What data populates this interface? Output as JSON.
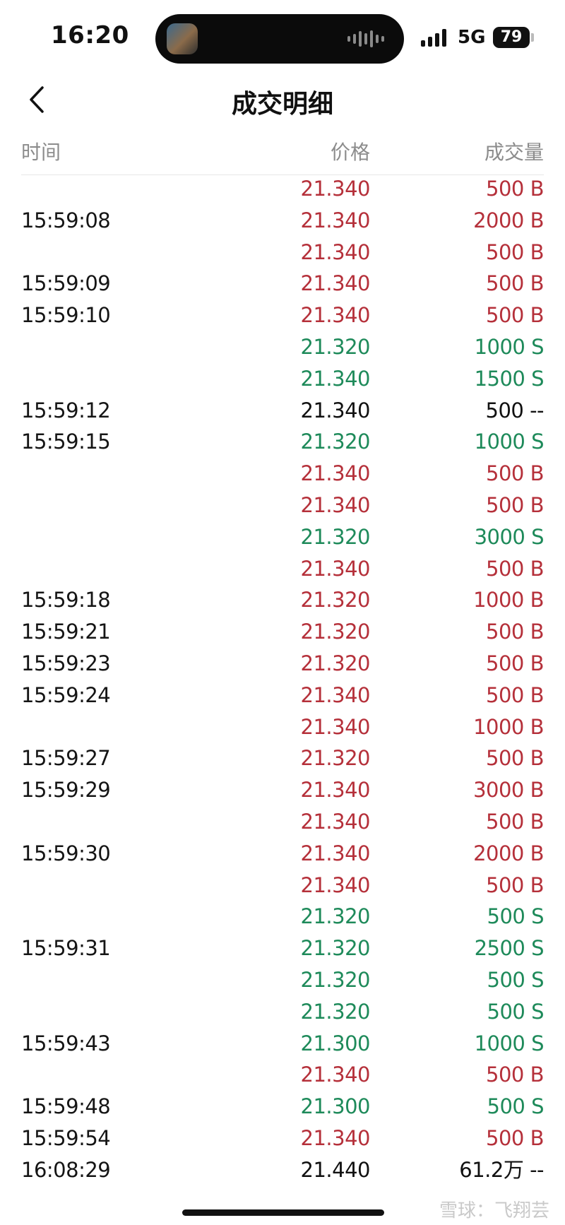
{
  "status_bar": {
    "time": "16:20",
    "network": "5G",
    "battery": "79"
  },
  "header": {
    "title": "成交明细"
  },
  "columns": {
    "time": "时间",
    "price": "价格",
    "volume": "成交量"
  },
  "colors": {
    "buy": "#b5303a",
    "sell": "#1e8a5a",
    "neutral": "#111111"
  },
  "trades": [
    {
      "time": "",
      "price": "21.340",
      "volume": "500 B",
      "side": "red"
    },
    {
      "time": "15:59:08",
      "price": "21.340",
      "volume": "2000 B",
      "side": "red"
    },
    {
      "time": "",
      "price": "21.340",
      "volume": "500 B",
      "side": "red"
    },
    {
      "time": "15:59:09",
      "price": "21.340",
      "volume": "500 B",
      "side": "red"
    },
    {
      "time": "15:59:10",
      "price": "21.340",
      "volume": "500 B",
      "side": "red"
    },
    {
      "time": "",
      "price": "21.320",
      "volume": "1000 S",
      "side": "green"
    },
    {
      "time": "",
      "price": "21.340",
      "volume": "1500 S",
      "side": "green"
    },
    {
      "time": "15:59:12",
      "price": "21.340",
      "volume": "500 --",
      "side": "black"
    },
    {
      "time": "15:59:15",
      "price": "21.320",
      "volume": "1000 S",
      "side": "green"
    },
    {
      "time": "",
      "price": "21.340",
      "volume": "500 B",
      "side": "red"
    },
    {
      "time": "",
      "price": "21.340",
      "volume": "500 B",
      "side": "red"
    },
    {
      "time": "",
      "price": "21.320",
      "volume": "3000 S",
      "side": "green"
    },
    {
      "time": "",
      "price": "21.340",
      "volume": "500 B",
      "side": "red"
    },
    {
      "time": "15:59:18",
      "price": "21.320",
      "volume": "1000 B",
      "side": "red"
    },
    {
      "time": "15:59:21",
      "price": "21.320",
      "volume": "500 B",
      "side": "red"
    },
    {
      "time": "15:59:23",
      "price": "21.320",
      "volume": "500 B",
      "side": "red"
    },
    {
      "time": "15:59:24",
      "price": "21.340",
      "volume": "500 B",
      "side": "red"
    },
    {
      "time": "",
      "price": "21.340",
      "volume": "1000 B",
      "side": "red"
    },
    {
      "time": "15:59:27",
      "price": "21.320",
      "volume": "500 B",
      "side": "red"
    },
    {
      "time": "15:59:29",
      "price": "21.340",
      "volume": "3000 B",
      "side": "red"
    },
    {
      "time": "",
      "price": "21.340",
      "volume": "500 B",
      "side": "red"
    },
    {
      "time": "15:59:30",
      "price": "21.340",
      "volume": "2000 B",
      "side": "red"
    },
    {
      "time": "",
      "price": "21.340",
      "volume": "500 B",
      "side": "red"
    },
    {
      "time": "",
      "price": "21.320",
      "volume": "500 S",
      "side": "green"
    },
    {
      "time": "15:59:31",
      "price": "21.320",
      "volume": "2500 S",
      "side": "green"
    },
    {
      "time": "",
      "price": "21.320",
      "volume": "500 S",
      "side": "green"
    },
    {
      "time": "",
      "price": "21.320",
      "volume": "500 S",
      "side": "green"
    },
    {
      "time": "15:59:43",
      "price": "21.300",
      "volume": "1000 S",
      "side": "green"
    },
    {
      "time": "",
      "price": "21.340",
      "volume": "500 B",
      "side": "red"
    },
    {
      "time": "15:59:48",
      "price": "21.300",
      "volume": "500 S",
      "side": "green"
    },
    {
      "time": "15:59:54",
      "price": "21.340",
      "volume": "500 B",
      "side": "red"
    },
    {
      "time": "16:08:29",
      "price": "21.440",
      "volume": "61.2万 --",
      "side": "black"
    }
  ],
  "watermark": "雪球：飞翔芸"
}
